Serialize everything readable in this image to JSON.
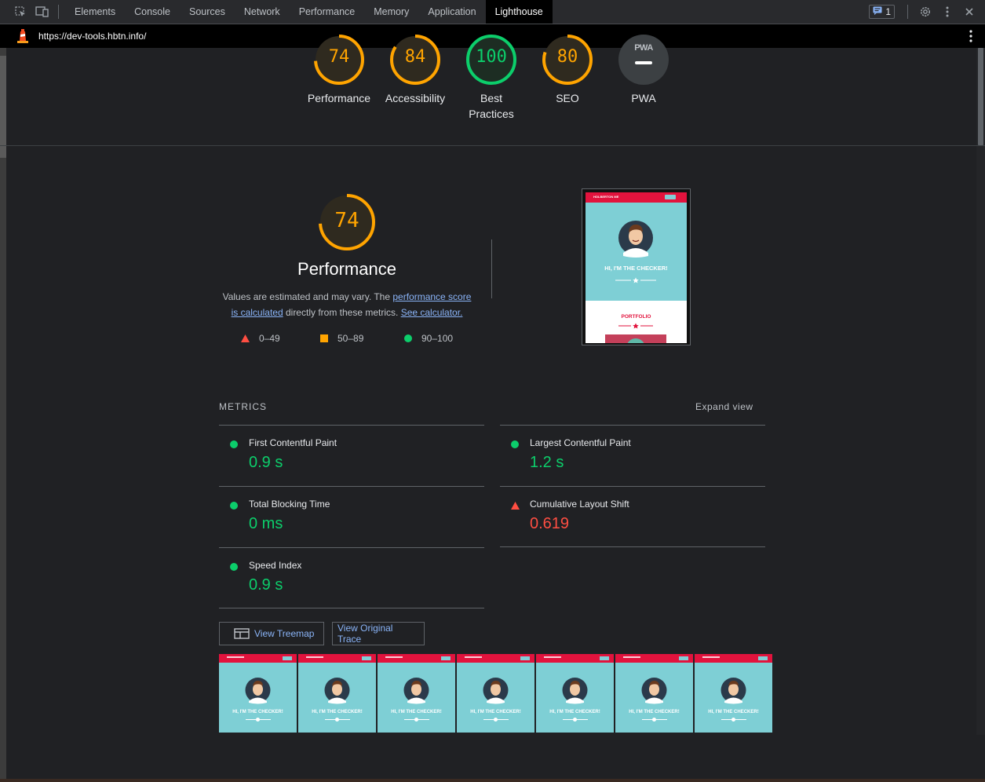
{
  "devtools": {
    "tabs": [
      "Elements",
      "Console",
      "Sources",
      "Network",
      "Performance",
      "Memory",
      "Application",
      "Lighthouse"
    ],
    "active_tab": "Lighthouse",
    "issues_count": "1"
  },
  "url": "https://dev-tools.hbtn.info/",
  "gauges": [
    {
      "score": "74",
      "label": "Performance",
      "color": "#ffa400"
    },
    {
      "score": "84",
      "label": "Accessibility",
      "color": "#ffa400"
    },
    {
      "score": "100",
      "label": "Best Practices",
      "color": "#0cce6b"
    },
    {
      "score": "80",
      "label": "SEO",
      "color": "#ffa400"
    },
    {
      "score": "",
      "label": "PWA",
      "badge": "PWA",
      "color": "#9aa0a6"
    }
  ],
  "performance": {
    "score": "74",
    "title": "Performance",
    "desc_prefix": "Values are estimated and may vary. The ",
    "link1": "performance score is calculated",
    "desc_middle": " directly from these metrics. ",
    "link2": "See calculator.",
    "legend": {
      "bad": "0–49",
      "average": "50–89",
      "good": "90–100"
    }
  },
  "preview": {
    "brand": "HOLBERTON ME",
    "hero_text": "HI, I'M THE CHECKER!",
    "section": "PORTFOLIO"
  },
  "metrics": {
    "title": "METRICS",
    "expand": "Expand view",
    "fcp": {
      "name": "First Contentful Paint",
      "value": "0.9 s",
      "status": "good"
    },
    "lcp": {
      "name": "Largest Contentful Paint",
      "value": "1.2 s",
      "status": "good"
    },
    "tbt": {
      "name": "Total Blocking Time",
      "value": "0 ms",
      "status": "good"
    },
    "cls": {
      "name": "Cumulative Layout Shift",
      "value": "0.619",
      "status": "bad"
    },
    "si": {
      "name": "Speed Index",
      "value": "0.9 s",
      "status": "good"
    }
  },
  "buttons": {
    "treemap": "View Treemap",
    "trace": "View Original Trace"
  },
  "filmstrip": {
    "frame_text": "HI, I'M THE CHECKER!",
    "frame_count": 7
  },
  "colors": {
    "good": "#0cce6b",
    "average": "#ffa400",
    "bad": "#ff4e42",
    "link": "#8ab4f8"
  }
}
